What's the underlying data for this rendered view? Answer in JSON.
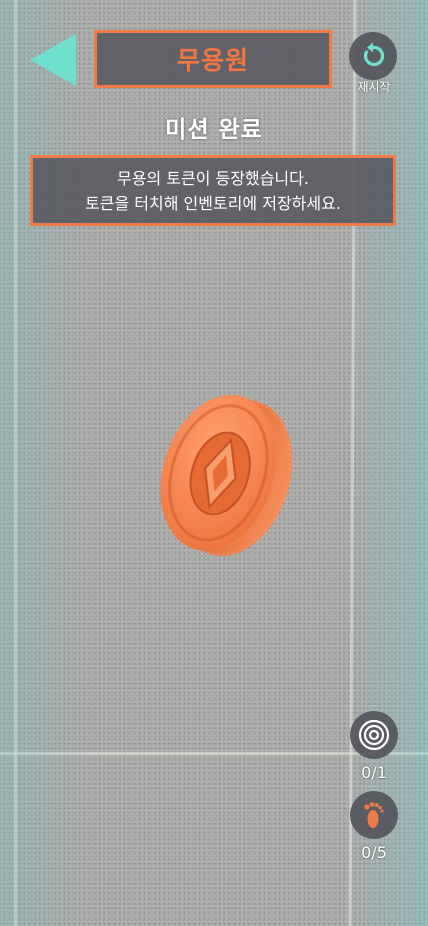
{
  "header": {
    "title": "무용원",
    "back_icon": "back-arrow-icon",
    "restart_icon": "restart-icon",
    "restart_label": "재시작"
  },
  "mission": {
    "heading": "미션 완료",
    "message_line1": "무용의 토큰이 등장했습니다.",
    "message_line2": "토큰을 터치해 인벤토리에 저장하세요."
  },
  "token": {
    "icon": "orange-coin-icon"
  },
  "counters": {
    "target_icon": "target-icon",
    "target_count": "0/1",
    "footprint_icon": "footprint-icon",
    "footprint_count": "0/5"
  },
  "colors": {
    "accent": "#ee7c48",
    "back_arrow": "#6fe0cf",
    "panel": "#58585f"
  }
}
